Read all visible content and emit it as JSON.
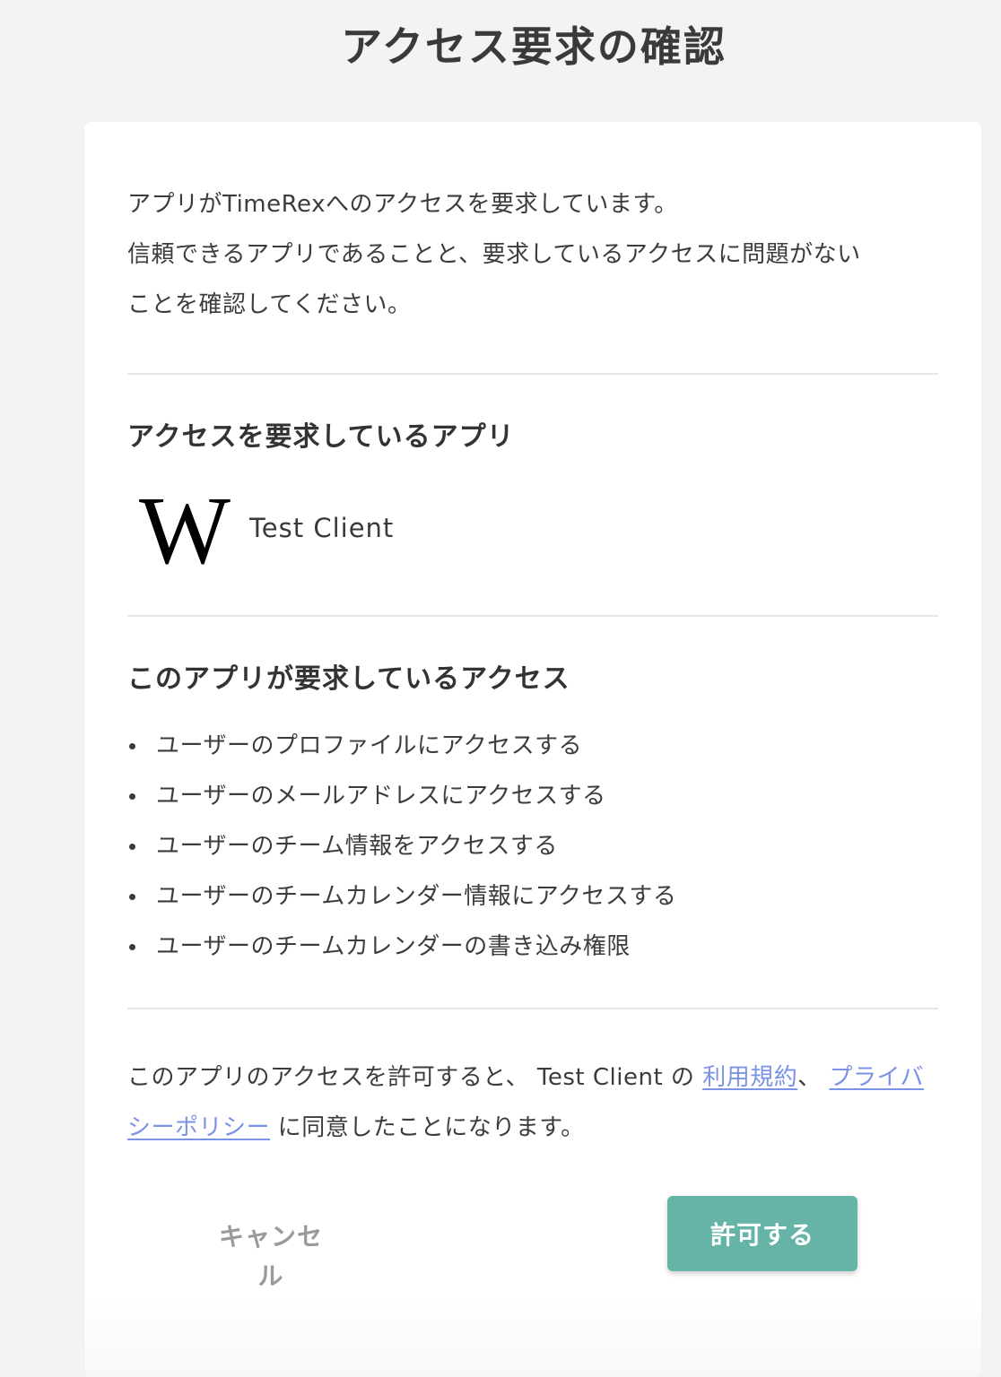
{
  "page": {
    "title": "アクセス要求の確認"
  },
  "intro": {
    "line1": "アプリがTimeRexへのアクセスを要求しています。",
    "line2": "信頼できるアプリであることと、要求しているアクセスに問題がない",
    "line3": "ことを確認してください。"
  },
  "app_section": {
    "heading": "アクセスを要求しているアプリ",
    "logo_icon": "wikipedia-w-logo",
    "logo_letter": "W",
    "app_name": "Test Client"
  },
  "access_section": {
    "heading": "このアプリが要求しているアクセス",
    "items": [
      "ユーザーのプロファイルにアクセスする",
      "ユーザーのメールアドレスにアクセスする",
      "ユーザーのチーム情報をアクセスする",
      "ユーザーのチームカレンダー情報にアクセスする",
      "ユーザーのチームカレンダーの書き込み権限"
    ]
  },
  "consent": {
    "prefix": "このアプリのアクセスを許可すると、 Test Client の ",
    "terms_link": "利用規約",
    "separator": "、 ",
    "privacy_link": "プライバシーポリシー",
    "suffix": " に同意したことになります。"
  },
  "actions": {
    "cancel_label": "キャンセル",
    "allow_label": "許可する"
  },
  "colors": {
    "background": "#f3f3f3",
    "card": "#ffffff",
    "link": "#7b93e6",
    "allow_button": "#66b4a8",
    "cancel_text": "#9a9a9a"
  }
}
